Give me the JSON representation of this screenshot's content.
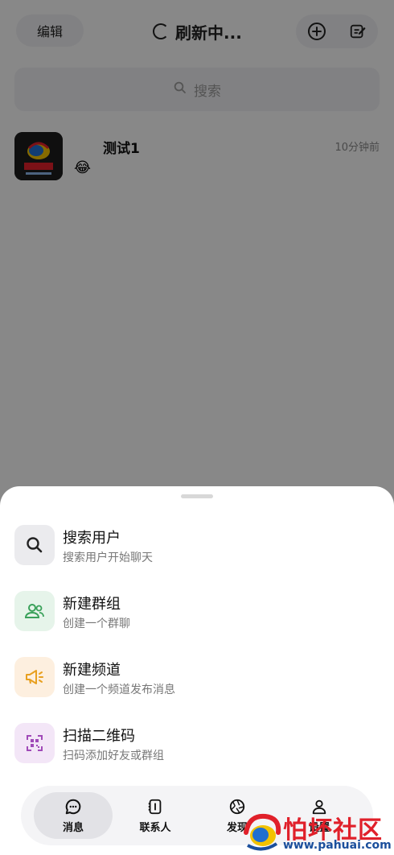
{
  "header": {
    "edit_label": "编辑",
    "title": "刷新中...",
    "add_icon": "plus-circle-icon",
    "compose_icon": "compose-icon"
  },
  "search": {
    "placeholder": "搜索"
  },
  "chats": [
    {
      "name": "测试1",
      "time": "10分钟前",
      "preview_emoji": "😂"
    }
  ],
  "sheet": {
    "items": [
      {
        "title": "搜索用户",
        "subtitle": "搜索用户开始聊天",
        "icon": "search-icon",
        "bg": "#ebebee",
        "fg": "#222222"
      },
      {
        "title": "新建群组",
        "subtitle": "创建一个群聊",
        "icon": "group-icon",
        "bg": "#e6f4ea",
        "fg": "#3aa15a"
      },
      {
        "title": "新建频道",
        "subtitle": "创建一个频道发布消息",
        "icon": "megaphone-icon",
        "bg": "#fdefdf",
        "fg": "#e8a020"
      },
      {
        "title": "扫描二维码",
        "subtitle": "扫码添加好友或群组",
        "icon": "qr-code-icon",
        "bg": "#f3e6f7",
        "fg": "#a04ab8"
      }
    ]
  },
  "tabs": [
    {
      "label": "消息",
      "icon": "chat-icon",
      "active": true
    },
    {
      "label": "联系人",
      "icon": "contacts-book-icon",
      "active": false
    },
    {
      "label": "发现",
      "icon": "aperture-icon",
      "active": false
    },
    {
      "label": "设置",
      "icon": "person-icon",
      "active": false
    }
  ],
  "watermark": {
    "text": "怕坏社区",
    "url": "www.pahuai.com"
  }
}
